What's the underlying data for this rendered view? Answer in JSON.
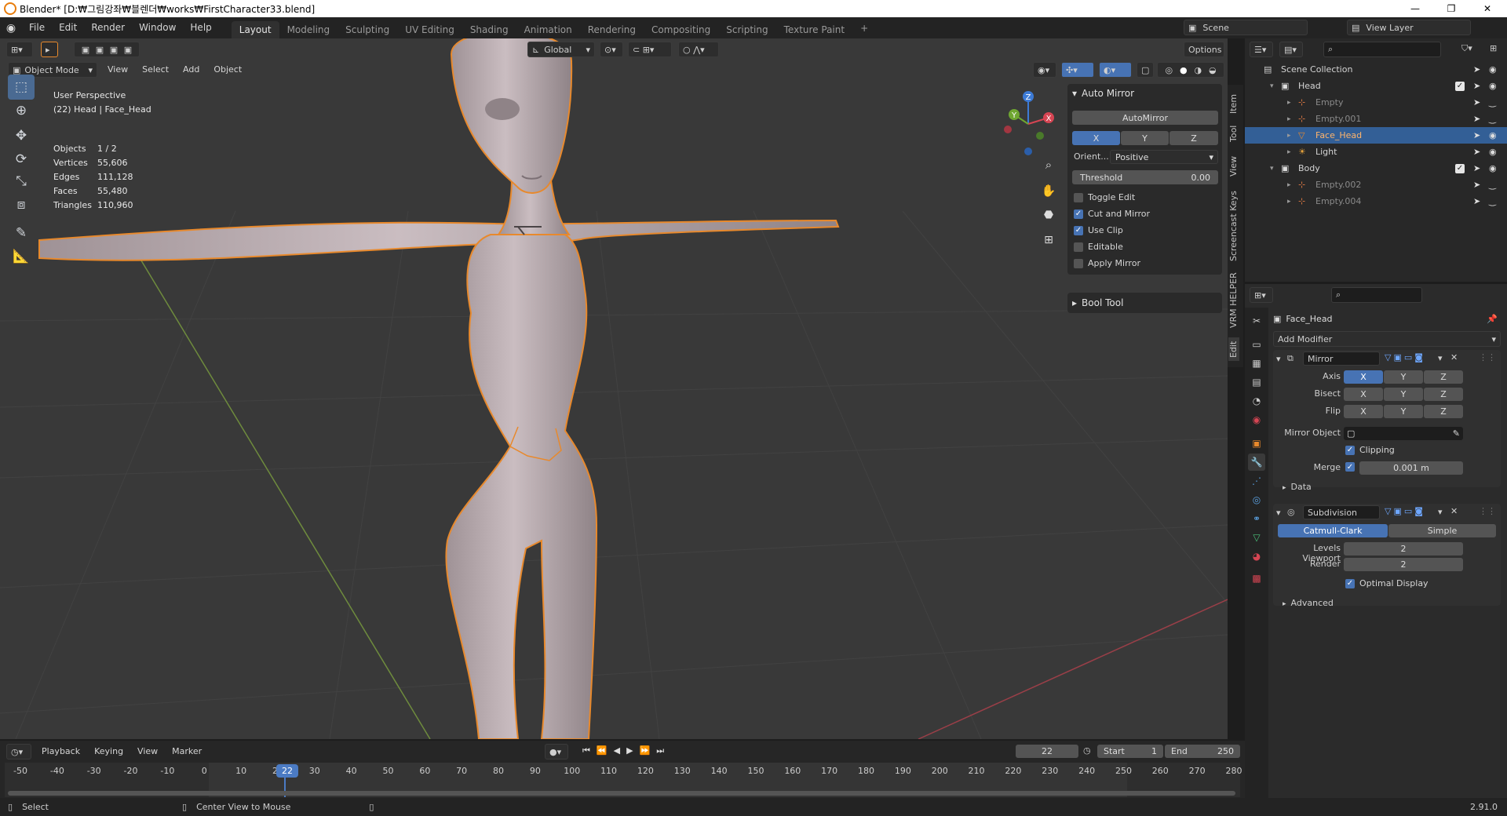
{
  "window": {
    "app_icon": "blender-logo-icon",
    "title": "Blender* [D:₩그림강좌₩블렌더₩works₩FirstCharacter33.blend]",
    "minimize": "—",
    "restore": "❐",
    "close": "✕"
  },
  "menubar": {
    "items": [
      "File",
      "Edit",
      "Render",
      "Window",
      "Help"
    ]
  },
  "workspaces": {
    "active": "Layout",
    "tabs": [
      "Layout",
      "Modeling",
      "Sculpting",
      "UV Editing",
      "Shading",
      "Animation",
      "Rendering",
      "Compositing",
      "Scripting",
      "Texture Paint"
    ],
    "add": "+"
  },
  "scene": {
    "name": "Scene",
    "view_layer": "View Layer"
  },
  "viewport_header": {
    "transform_orientation": "Global",
    "options": "Options",
    "mode": "Object Mode",
    "menus": [
      "View",
      "Select",
      "Add",
      "Object"
    ]
  },
  "overlay": {
    "perspective": "User Perspective",
    "context": "(22) Head | Face_Head",
    "stats": [
      {
        "label": "Objects",
        "value": "1 / 2"
      },
      {
        "label": "Vertices",
        "value": "55,606"
      },
      {
        "label": "Edges",
        "value": "111,128"
      },
      {
        "label": "Faces",
        "value": "55,480"
      },
      {
        "label": "Triangles",
        "value": "110,960"
      }
    ]
  },
  "gizmo": {
    "x": "X",
    "y": "Y",
    "z": "Z"
  },
  "toolbar": {
    "tools": [
      "select-box-icon",
      "cursor-icon",
      "move-icon",
      "rotate-icon",
      "scale-icon",
      "transform-icon",
      "annotate-icon",
      "measure-icon"
    ]
  },
  "npanel": {
    "auto_mirror": {
      "title": "Auto Mirror",
      "button": "AutoMirror",
      "axes": [
        "X",
        "Y",
        "Z"
      ],
      "active_axis": "X",
      "orient_label": "Orient...",
      "orient_value": "Positive",
      "threshold_label": "Threshold",
      "threshold_value": "0.00",
      "checks": [
        {
          "label": "Toggle Edit",
          "checked": false
        },
        {
          "label": "Cut and Mirror",
          "checked": true
        },
        {
          "label": "Use Clip",
          "checked": true
        },
        {
          "label": "Editable",
          "checked": false
        },
        {
          "label": "Apply Mirror",
          "checked": false
        }
      ]
    },
    "bool_tool": {
      "title": "Bool Tool"
    },
    "tabs": [
      "Item",
      "Tool",
      "View",
      "Screencast Keys",
      "VRM HELPER",
      "Edit"
    ]
  },
  "outliner": {
    "search_placeholder": "",
    "rows": [
      {
        "label": "Scene Collection",
        "depth": 0,
        "type": "scene-collection-icon"
      },
      {
        "label": "Head",
        "depth": 1,
        "type": "collection-icon",
        "checked": true
      },
      {
        "label": "Empty",
        "depth": 2,
        "type": "empty-icon",
        "dim": true
      },
      {
        "label": "Empty.001",
        "depth": 2,
        "type": "empty-icon",
        "dim": true
      },
      {
        "label": "Face_Head",
        "depth": 2,
        "type": "mesh-icon",
        "selected": true
      },
      {
        "label": "Light",
        "depth": 2,
        "type": "light-icon"
      },
      {
        "label": "Body",
        "depth": 1,
        "type": "collection-icon",
        "checked": true
      },
      {
        "label": "Empty.002",
        "depth": 2,
        "type": "empty-icon",
        "dim": true
      },
      {
        "label": "Empty.004",
        "depth": 2,
        "type": "empty-icon",
        "dim": true
      }
    ]
  },
  "properties": {
    "object_name": "Face_Head",
    "add_modifier": "Add Modifier",
    "mirror": {
      "name": "Mirror",
      "axis_label": "Axis",
      "bisect_label": "Bisect",
      "flip_label": "Flip",
      "xyz": [
        "X",
        "Y",
        "Z"
      ],
      "mirror_object_label": "Mirror Object",
      "clipping_label": "Clipping",
      "merge_label": "Merge",
      "merge_value": "0.001 m",
      "data_label": "Data"
    },
    "subdivision": {
      "name": "Subdivision",
      "mode_a": "Catmull-Clark",
      "mode_b": "Simple",
      "levels_label": "Levels Viewport",
      "levels_value": "2",
      "render_label": "Render",
      "render_value": "2",
      "optimal_label": "Optimal Display",
      "advanced_label": "Advanced"
    }
  },
  "timeline": {
    "menus": [
      "Playback",
      "Keying",
      "View",
      "Marker"
    ],
    "current_frame": "22",
    "start_label": "Start",
    "start": "1",
    "end_label": "End",
    "end": "250",
    "ticks": [
      "-50",
      "-40",
      "-30",
      "-20",
      "-10",
      "0",
      "10",
      "20",
      "30",
      "40",
      "50",
      "60",
      "70",
      "80",
      "90",
      "100",
      "110",
      "120",
      "130",
      "140",
      "150",
      "160",
      "170",
      "180",
      "190",
      "200",
      "210",
      "220",
      "230",
      "240",
      "250",
      "260",
      "270",
      "280"
    ]
  },
  "statusbar": {
    "left": "Select",
    "middle": "Center View to Mouse",
    "version": "2.91.0"
  },
  "colors": {
    "accent": "#4773b4",
    "selection_outline": "#e8892c",
    "body": "#c3b5b9"
  }
}
